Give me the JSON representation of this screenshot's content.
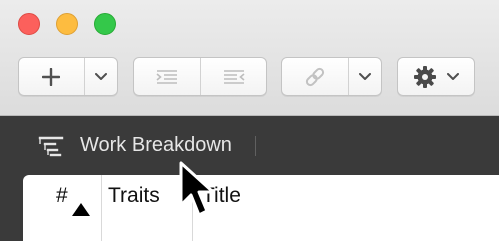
{
  "window": {
    "traffic_lights": [
      "close",
      "minimize",
      "zoom"
    ],
    "colors": {
      "close": "#fc605c",
      "minimize": "#fdbc40",
      "zoom": "#34c84a"
    }
  },
  "toolbar": {
    "add_icon": "plus-icon",
    "add_menu_icon": "chevron-down-icon",
    "indent_icon": "indent-icon",
    "outdent_icon": "outdent-icon",
    "link_icon": "link-icon",
    "link_menu_icon": "chevron-down-icon",
    "settings_icon": "gear-icon",
    "settings_menu_icon": "chevron-down-icon"
  },
  "view": {
    "icon": "work-breakdown-icon",
    "title": "Work Breakdown"
  },
  "outline": {
    "columns": [
      {
        "label": "#",
        "sorted": "ascending"
      },
      {
        "label": "Traits"
      },
      {
        "label": "Title"
      }
    ]
  },
  "colors": {
    "view_bar": "#3a3a3a",
    "toolbar": "#e4e4e4",
    "pane": "#ffffff"
  }
}
